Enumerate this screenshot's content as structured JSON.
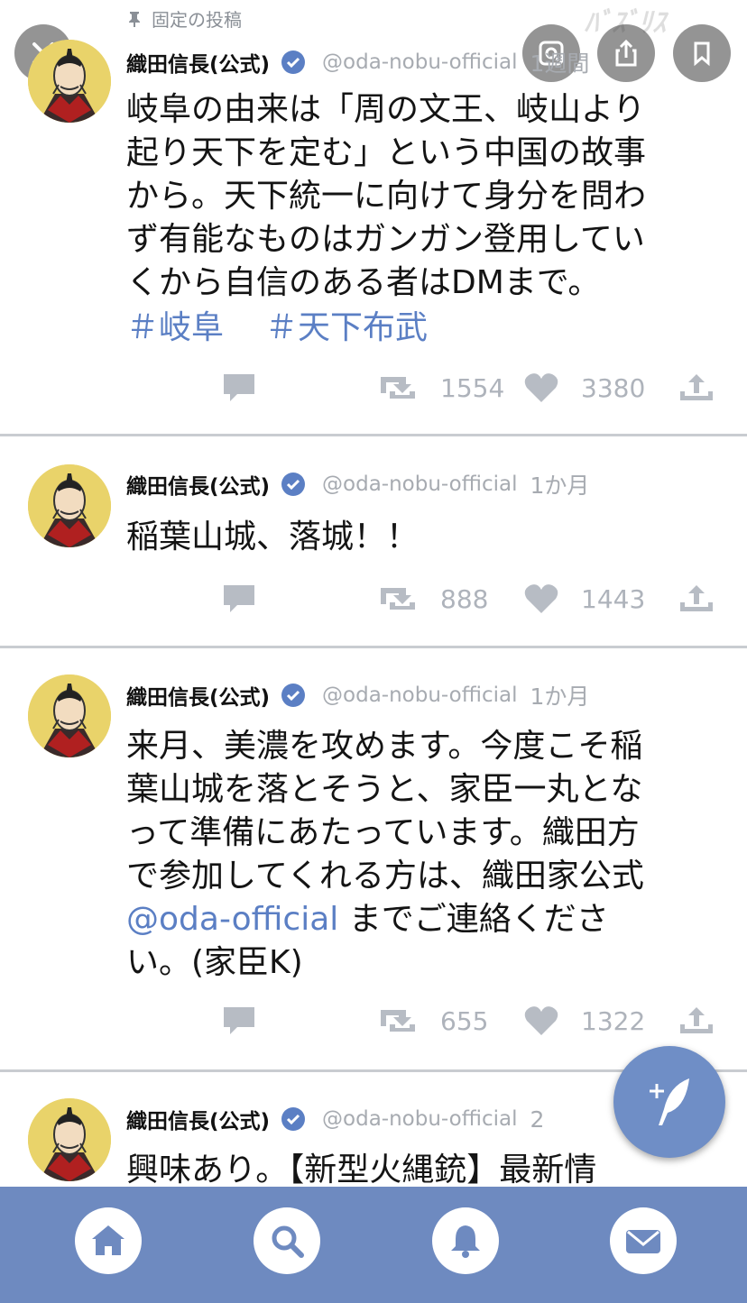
{
  "pinned_label": "固定の投稿",
  "watermark": "ﾊﾞｽﾞﾘｽ",
  "colors": {
    "accent": "#5b7fc4",
    "tabbar": "#6e8ac0",
    "fab": "#6f8ec6",
    "muted": "#aeb3bb"
  },
  "tweets": [
    {
      "name": "織田信長(公式)",
      "handle": "@oda-nobu-official",
      "time": "1週間",
      "text_lines": [
        "岐阜の由来は「周の文王、岐山より",
        "起り天下を定む」という中国の故事",
        "から。天下統一に向けて身分を問わ",
        "ず有能なものはガンガン登用してい",
        "くから自信のある者はDMまで。"
      ],
      "hashtags": [
        "＃岐阜",
        "＃天下布武"
      ],
      "retweets": "1554",
      "likes": "3380"
    },
    {
      "name": "織田信長(公式)",
      "handle": "@oda-nobu-official",
      "time": "1か月",
      "text_lines": [
        "稲葉山城、落城！！"
      ],
      "retweets": "888",
      "likes": "1443"
    },
    {
      "name": "織田信長(公式)",
      "handle": "@oda-nobu-official",
      "time": "1か月",
      "text_lines": [
        "来月、美濃を攻めます。今度こそ稲",
        "葉山城を落とそうと、家臣一丸とな",
        "って準備にあたっています。織田方",
        "で参加してくれる方は、織田家公式"
      ],
      "mention": "@oda-official",
      "mention_suffix": " までご連絡くださ",
      "last_line": "い。(家臣K)",
      "retweets": "655",
      "likes": "1322"
    },
    {
      "name": "織田信長(公式)",
      "handle": "@oda-nobu-official",
      "time": "2",
      "text_lines": [
        "興味あり。【新型火縄銃】最新情"
      ]
    }
  ],
  "icons": {
    "overlay": [
      "close-icon",
      "lens-icon",
      "share-icon",
      "bookmark-icon"
    ],
    "tabs": [
      "home-icon",
      "search-icon",
      "bell-icon",
      "mail-icon"
    ],
    "fab": "compose-quill-icon"
  }
}
